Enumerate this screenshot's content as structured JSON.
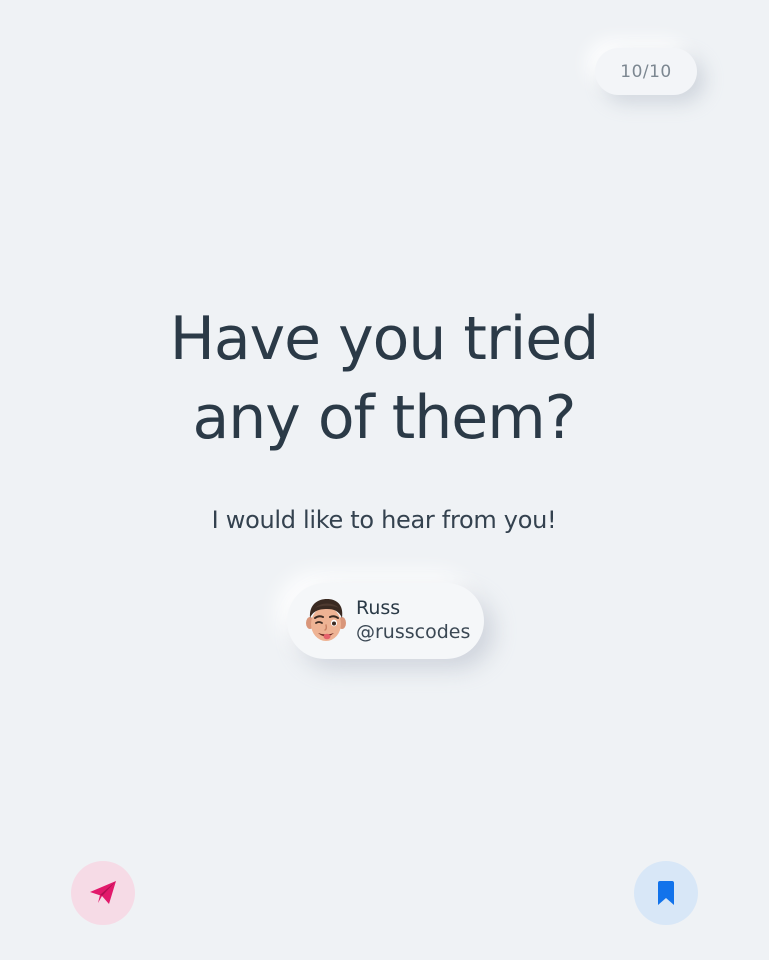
{
  "page_counter": "10/10",
  "headline": {
    "line1": "Have you tried",
    "line2": "any of them?"
  },
  "subtitle": "I would like to hear from you!",
  "author": {
    "name": "Russ",
    "handle": "@russcodes",
    "avatar_icon": "memoji-avatar-icon"
  },
  "actions": {
    "share_icon": "paper-plane-icon",
    "save_icon": "bookmark-icon"
  },
  "colors": {
    "background": "#eff2f5",
    "text": "#2b3a47",
    "share_accent": "#e2196b",
    "share_bg": "#f6dbe6",
    "save_accent": "#1273eb",
    "save_bg": "#d8e7f7"
  }
}
